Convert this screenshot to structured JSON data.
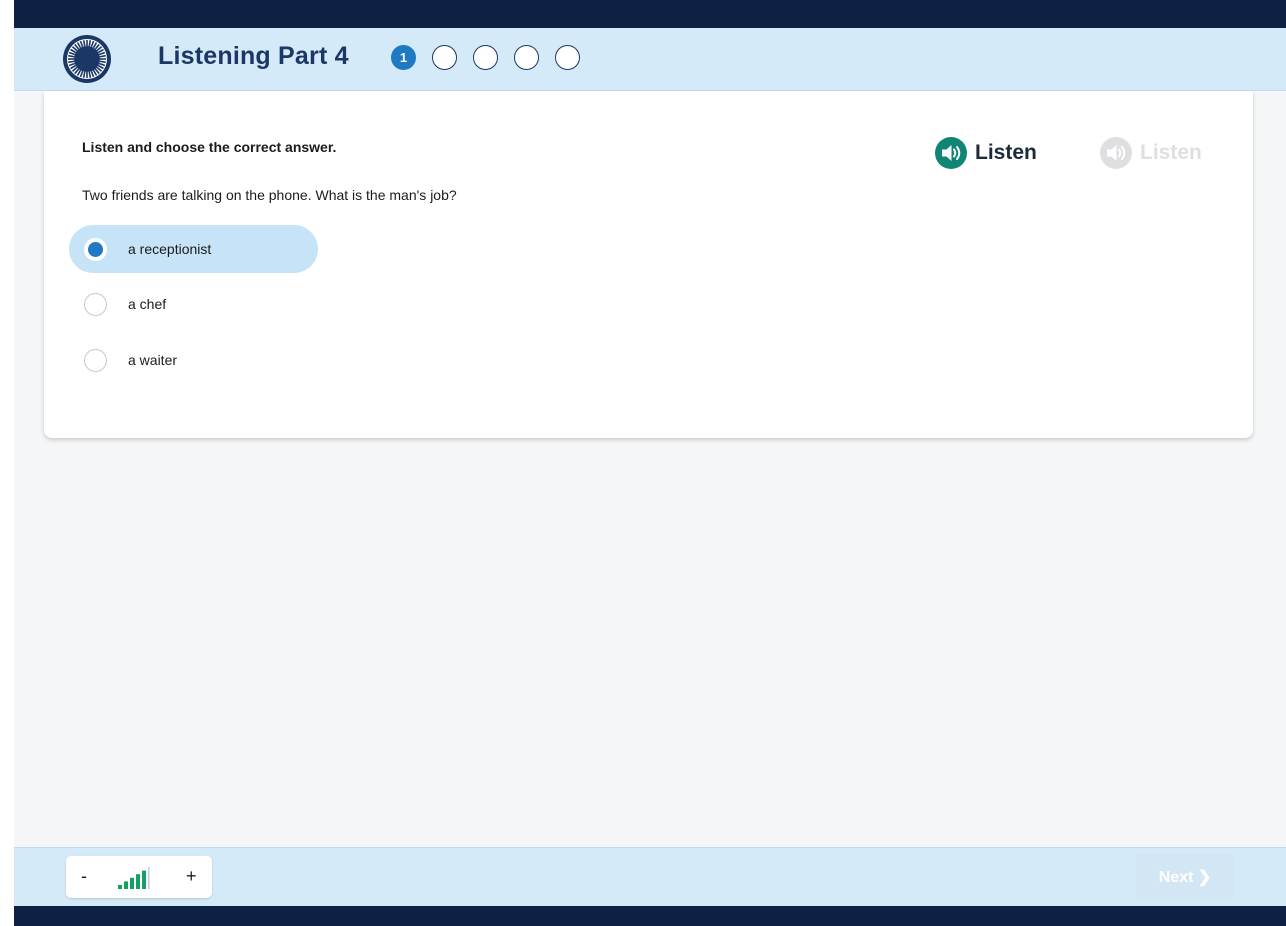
{
  "header": {
    "title": "Listening Part 4",
    "steps": [
      {
        "label": "1",
        "active": true
      },
      {
        "label": "",
        "active": false
      },
      {
        "label": "",
        "active": false
      },
      {
        "label": "",
        "active": false
      },
      {
        "label": "",
        "active": false
      }
    ]
  },
  "question": {
    "instruction": "Listen and choose the correct answer.",
    "text": "Two friends are talking on the phone. What is the man's job?",
    "options": [
      {
        "label": "a receptionist",
        "selected": true
      },
      {
        "label": "a chef",
        "selected": false
      },
      {
        "label": "a waiter",
        "selected": false
      }
    ],
    "listen_primary": "Listen",
    "listen_disabled": "Listen"
  },
  "footer": {
    "volume_minus": "-",
    "volume_plus": "+",
    "volume_level": 5,
    "volume_max": 6,
    "next_label": "Next ❯"
  },
  "colors": {
    "navy": "#0f2143",
    "header_bg": "#d5eaf8",
    "accent_blue": "#1f7ac3",
    "listen_green": "#0f8576",
    "volume_green": "#14a060"
  },
  "icons": {
    "logo": "british-council-sunburst-logo",
    "listen": "speaker-icon"
  }
}
